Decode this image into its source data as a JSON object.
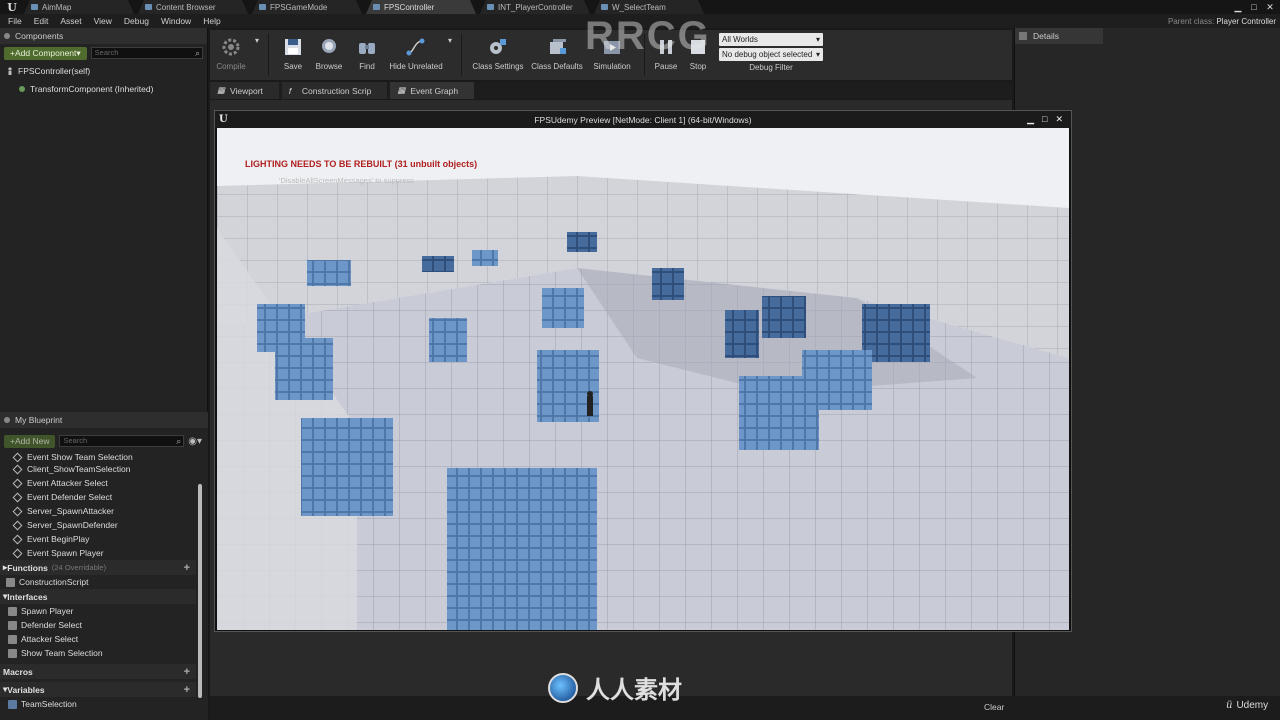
{
  "titlebar": {
    "tabs": [
      {
        "label": "AimMap"
      },
      {
        "label": "Content Browser"
      },
      {
        "label": "FPSGameMode"
      },
      {
        "label": "FPSController"
      },
      {
        "label": "INT_PlayerController"
      },
      {
        "label": "W_SelectTeam"
      }
    ],
    "parent_class_label": "Parent class:",
    "parent_class_value": "Player Controller"
  },
  "menu": [
    "File",
    "Edit",
    "Asset",
    "View",
    "Debug",
    "Window",
    "Help"
  ],
  "components": {
    "header": "Components",
    "add_button": "+Add Component▾",
    "search_placeholder": "Search",
    "root": "FPSController(self)",
    "child": "TransformComponent (Inherited)"
  },
  "toolbar": {
    "buttons": [
      {
        "label": "Compile"
      },
      {
        "label": "Save"
      },
      {
        "label": "Browse"
      },
      {
        "label": "Find"
      },
      {
        "label": "Hide Unrelated"
      },
      {
        "label": "Class Settings"
      },
      {
        "label": "Class Defaults"
      },
      {
        "label": "Simulation"
      },
      {
        "label": "Pause"
      },
      {
        "label": "Stop"
      }
    ],
    "debug_world": "All Worlds",
    "debug_object": "No debug object selected",
    "debug_filter_label": "Debug Filter"
  },
  "editor_tabs": [
    "Viewport",
    "Construction Scrip",
    "Event Graph"
  ],
  "my_blueprint": {
    "header": "My Blueprint",
    "add_new": "+Add New",
    "search_placeholder": "Search",
    "events": [
      "Event Show Team Selection",
      "Client_ShowTeamSelection",
      "Event Attacker Select",
      "Event Defender Select",
      "Server_SpawnAttacker",
      "Server_SpawnDefender",
      "Event BeginPlay",
      "Event Spawn Player"
    ],
    "functions_label": "Functions",
    "functions_count": "(24 Overridable)",
    "functions": [
      "ConstructionScript"
    ],
    "interfaces_label": "Interfaces",
    "interfaces": [
      "Spawn Player",
      "Defender Select",
      "Attacker Select",
      "Show Team Selection"
    ],
    "macros_label": "Macros",
    "variables_label": "Variables",
    "variables": [
      "TeamSelection"
    ]
  },
  "details": {
    "header": "Details"
  },
  "pie": {
    "title": "FPSUdemy Preview [NetMode: Client 1] (64-bit/Windows)",
    "lighting_warning": "LIGHTING NEEDS TO BE REBUILT (31 unbuilt objects)",
    "disable_hint": "'DisableAllScreenMessages' to suppress"
  },
  "status": {
    "clear": "Clear"
  },
  "watermarks": {
    "top": "RRCG",
    "bottom": "人人素材",
    "udemy": "Udemy"
  }
}
